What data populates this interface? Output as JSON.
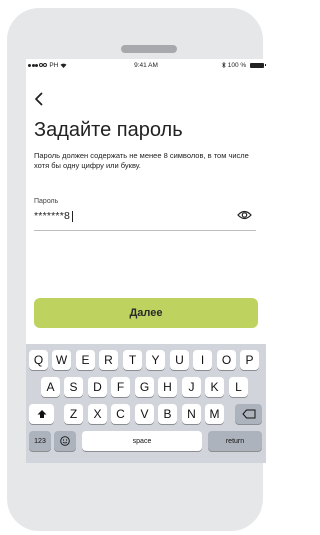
{
  "status_bar": {
    "carrier": "PH",
    "time": "9:41 AM",
    "battery": "100 %"
  },
  "screen": {
    "title": "Задайте пароль",
    "description": "Пароль должен содержать не менее 8 символов, в том числе хотя бы одну цифру или букву.",
    "password_label": "Пароль",
    "password_value": "*******8",
    "next_button": "Далее"
  },
  "keyboard": {
    "row1": [
      "Q",
      "W",
      "E",
      "R",
      "T",
      "Y",
      "U",
      "I",
      "O",
      "P"
    ],
    "row2": [
      "A",
      "S",
      "D",
      "F",
      "G",
      "H",
      "J",
      "K",
      "L"
    ],
    "row3": [
      "Z",
      "X",
      "C",
      "V",
      "B",
      "N",
      "M"
    ],
    "numbers": "123",
    "space": "space",
    "return": "return"
  },
  "icons": {
    "back": "chevron-left-icon",
    "show_password": "eye-icon",
    "shift": "shift-icon",
    "delete": "backspace-icon",
    "emoji": "emoji-icon",
    "wifi": "wifi-icon",
    "bluetooth": "bluetooth-icon"
  }
}
